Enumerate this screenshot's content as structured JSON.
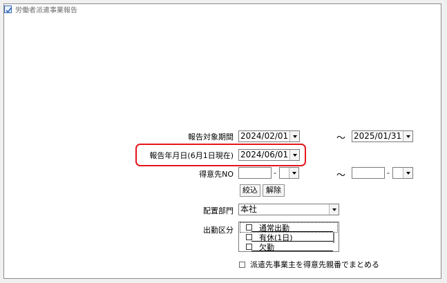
{
  "window": {
    "title": "労働者派遣事業報告"
  },
  "report_period": {
    "label": "報告対象期間",
    "from": "2024/02/01",
    "separator": "～",
    "to": "2025/01/31"
  },
  "report_date": {
    "label": "報告年月日(6月1日現在)",
    "value": "2024/06/01"
  },
  "customer_no": {
    "label": "得意先NO",
    "from_code": "",
    "from_branch": "",
    "separator": "～",
    "to_code": "",
    "to_branch": "",
    "hyphen": "-"
  },
  "buttons": {
    "filter": "絞込",
    "clear": "解除"
  },
  "department": {
    "label": "配置部門",
    "value": "本社"
  },
  "attendance": {
    "label": "出勤区分",
    "items": [
      "通常出勤",
      "有休(1日)",
      "欠勤"
    ]
  },
  "group_option": {
    "label": "派遣先事業主を得意先親番でまとめる",
    "checked": false
  },
  "colors": {
    "highlight": "#e4141b"
  }
}
